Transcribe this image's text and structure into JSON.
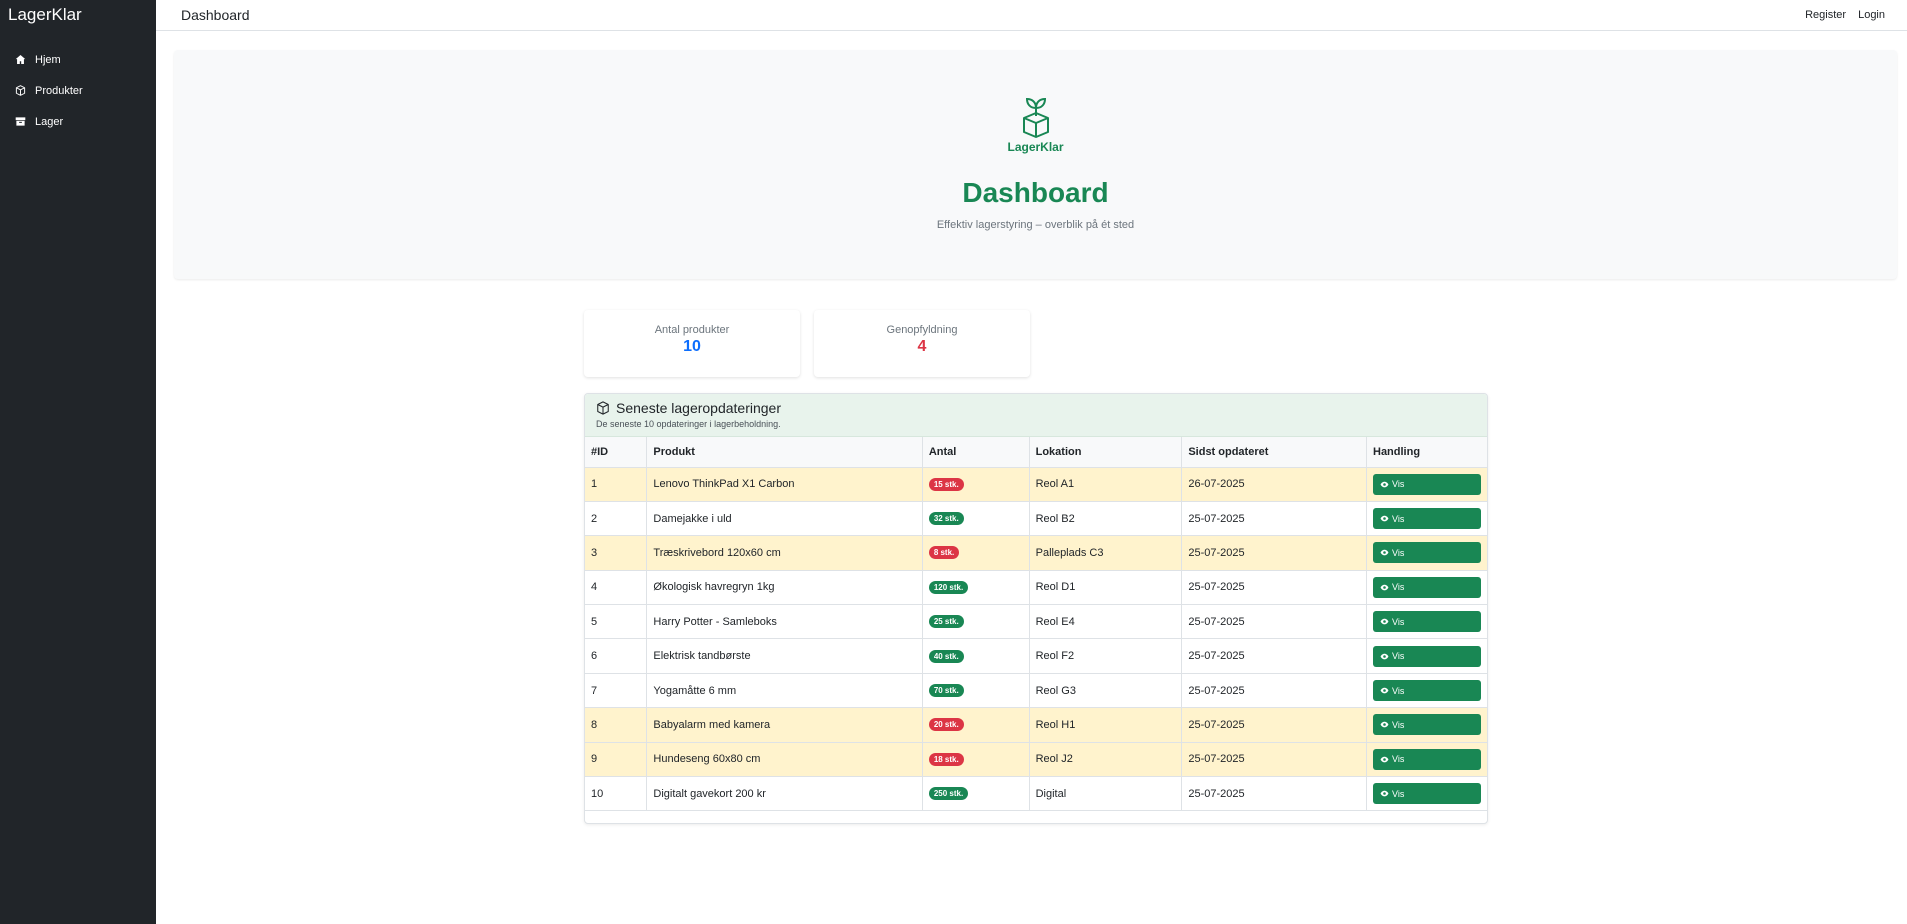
{
  "app": {
    "brand": "LagerKlar"
  },
  "sidebar": {
    "items": [
      {
        "label": "Hjem",
        "icon": "home-icon"
      },
      {
        "label": "Produkter",
        "icon": "box-icon"
      },
      {
        "label": "Lager",
        "icon": "archive-icon"
      }
    ]
  },
  "topbar": {
    "title": "Dashboard",
    "register": "Register",
    "login": "Login"
  },
  "hero": {
    "logo_text": "LagerKlar",
    "title": "Dashboard",
    "subtitle": "Effektiv lagerstyring – overblik på ét sted"
  },
  "stats": [
    {
      "label": "Antal produkter",
      "value": "10",
      "color": "#0d6efd"
    },
    {
      "label": "Genopfyldning",
      "value": "4",
      "color": "#dc3545"
    }
  ],
  "updates": {
    "title": "Seneste lageropdateringer",
    "subtitle": "De seneste 10 opdateringer i lagerbeholdning.",
    "columns": [
      "#ID",
      "Produkt",
      "Antal",
      "Lokation",
      "Sidst opdateret",
      "Handling"
    ],
    "action_label": "Vis",
    "rows": [
      {
        "id": "1",
        "product": "Lenovo ThinkPad X1 Carbon",
        "qty": "15 stk.",
        "low": true,
        "location": "Reol A1",
        "updated": "26-07-2025"
      },
      {
        "id": "2",
        "product": "Damejakke i uld",
        "qty": "32 stk.",
        "low": false,
        "location": "Reol B2",
        "updated": "25-07-2025"
      },
      {
        "id": "3",
        "product": "Træskrivebord 120x60 cm",
        "qty": "8 stk.",
        "low": true,
        "location": "Palleplads C3",
        "updated": "25-07-2025"
      },
      {
        "id": "4",
        "product": "Økologisk havregryn 1kg",
        "qty": "120 stk.",
        "low": false,
        "location": "Reol D1",
        "updated": "25-07-2025"
      },
      {
        "id": "5",
        "product": "Harry Potter - Samleboks",
        "qty": "25 stk.",
        "low": false,
        "location": "Reol E4",
        "updated": "25-07-2025"
      },
      {
        "id": "6",
        "product": "Elektrisk tandbørste",
        "qty": "40 stk.",
        "low": false,
        "location": "Reol F2",
        "updated": "25-07-2025"
      },
      {
        "id": "7",
        "product": "Yogamåtte 6 mm",
        "qty": "70 stk.",
        "low": false,
        "location": "Reol G3",
        "updated": "25-07-2025"
      },
      {
        "id": "8",
        "product": "Babyalarm med kamera",
        "qty": "20 stk.",
        "low": true,
        "location": "Reol H1",
        "updated": "25-07-2025"
      },
      {
        "id": "9",
        "product": "Hundeseng 60x80 cm",
        "qty": "18 stk.",
        "low": true,
        "location": "Reol J2",
        "updated": "25-07-2025"
      },
      {
        "id": "10",
        "product": "Digitalt gavekort 200 kr",
        "qty": "250 stk.",
        "low": false,
        "location": "Digital",
        "updated": "25-07-2025"
      }
    ]
  }
}
